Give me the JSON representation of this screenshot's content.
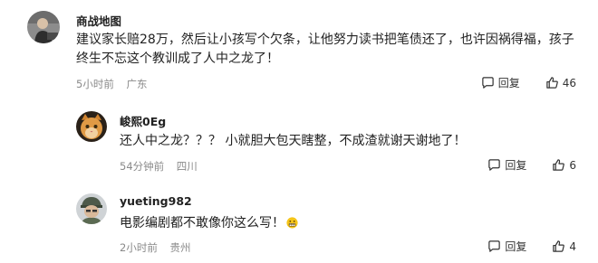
{
  "comments": [
    {
      "username": "商战地图",
      "text": "建议家长赔28万，然后让小孩写个欠条，让他努力读书把笔债还了，也许因祸得福，孩子终生不忘这个教训成了人中之龙了！",
      "time": "5小时前",
      "location": "广东",
      "reply_label": "回复",
      "likes": "46"
    },
    {
      "username": "峻熙0Eg",
      "text": "还人中之龙？？？ 小就胆大包天瞎整，不成渣就谢天谢地了！",
      "time": "54分钟前",
      "location": "四川",
      "reply_label": "回复",
      "likes": "6"
    },
    {
      "username": "yueting982",
      "text": "电影编剧都不敢像你这么写！",
      "time": "2小时前",
      "location": "贵州",
      "reply_label": "回复",
      "likes": "4"
    }
  ],
  "icons": {
    "reply": "reply-bubble-icon",
    "like": "thumbs-up-icon",
    "emoji": "grimacing-face-emoji"
  }
}
